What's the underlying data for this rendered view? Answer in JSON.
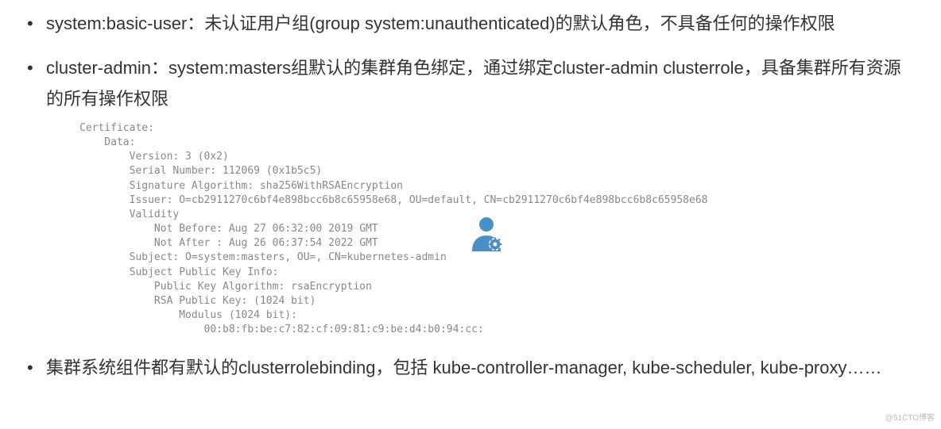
{
  "bullets": {
    "item1": "system:basic-user：未认证用户组(group system:unauthenticated)的默认角色，不具备任何的操作权限",
    "item2": "cluster-admin：system:masters组默认的集群角色绑定，通过绑定cluster-admin clusterrole，具备集群所有资源的所有操作权限",
    "item3": "集群系统组件都有默认的clusterrolebinding，包括 kube-controller-manager, kube-scheduler, kube-proxy……"
  },
  "certificate": {
    "text": "Certificate:\n    Data:\n        Version: 3 (0x2)\n        Serial Number: 112069 (0x1b5c5)\n        Signature Algorithm: sha256WithRSAEncryption\n        Issuer: O=cb2911270c6bf4e898bcc6b8c65958e68, OU=default, CN=cb2911270c6bf4e898bcc6b8c65958e68\n        Validity\n            Not Before: Aug 27 06:32:00 2019 GMT\n            Not After : Aug 26 06:37:54 2022 GMT\n        Subject: O=system:masters, OU=, CN=kubernetes-admin\n        Subject Public Key Info:\n            Public Key Algorithm: rsaEncryption\n            RSA Public Key: (1024 bit)\n                Modulus (1024 bit):\n                    00:b8:fb:be:c7:82:cf:09:81:c9:be:d4:b0:94:cc:"
  },
  "watermark": "@51CTO博客"
}
